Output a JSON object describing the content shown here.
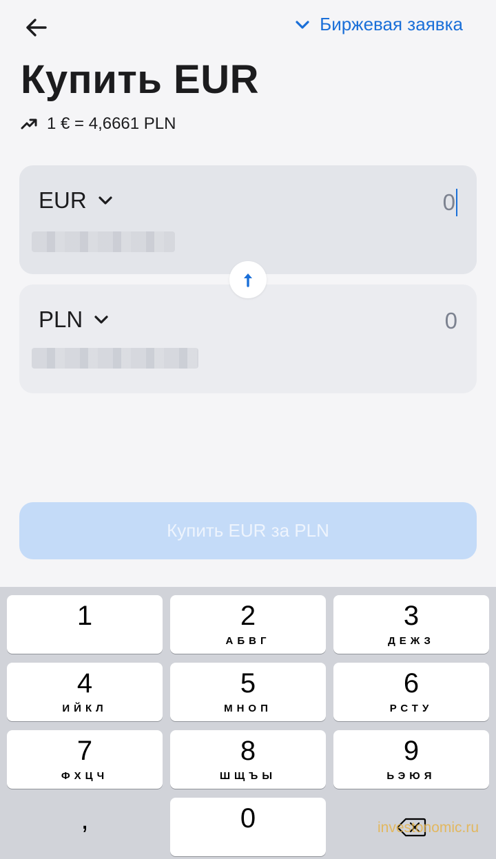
{
  "header": {
    "back_icon": "arrow-left-icon",
    "order_type_icon": "chevron-down-icon",
    "order_type_label": "Биржевая заявка"
  },
  "title": "Купить EUR",
  "rate": {
    "icon": "trend-up-icon",
    "text": "1 € = 4,6661 PLN"
  },
  "from_card": {
    "currency": "EUR",
    "amount": "0"
  },
  "to_card": {
    "currency": "PLN",
    "amount": "0"
  },
  "swap_icon": "arrow-up-icon",
  "buy_button_label": "Купить EUR за PLN",
  "keypad": {
    "keys": [
      {
        "digit": "1",
        "letters": ""
      },
      {
        "digit": "2",
        "letters": "АБВГ"
      },
      {
        "digit": "3",
        "letters": "ДЕЖЗ"
      },
      {
        "digit": "4",
        "letters": "ИЙКЛ"
      },
      {
        "digit": "5",
        "letters": "МНОП"
      },
      {
        "digit": "6",
        "letters": "РСТУ"
      },
      {
        "digit": "7",
        "letters": "ФХЦЧ"
      },
      {
        "digit": "8",
        "letters": "ШЩЪЫ"
      },
      {
        "digit": "9",
        "letters": "ЬЭЮЯ"
      },
      {
        "digit": "0",
        "letters": ""
      }
    ],
    "comma": ",",
    "delete_icon": "backspace-icon"
  },
  "watermark": "investonomic.ru",
  "colors": {
    "accent": "#1a6fd8",
    "button_disabled": "#c4dbf8",
    "background": "#f5f5f7",
    "keypad_background": "#d1d3d9"
  }
}
